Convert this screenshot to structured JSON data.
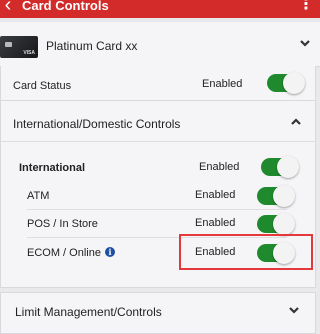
{
  "appbar": {
    "title": "Card Controls",
    "back_icon": "chevron-left-icon",
    "more_icon": "more-vertical-icon",
    "background": "#d32a2a"
  },
  "card": {
    "name": "Platinum Card xx",
    "brand_mark": "VISA"
  },
  "card_status": {
    "label": "Card Status",
    "value": "Enabled",
    "enabled": true
  },
  "intl_section": {
    "title": "International/Domestic Controls",
    "rows": [
      {
        "label": "International",
        "value": "Enabled",
        "enabled": true
      },
      {
        "label": "ATM",
        "value": "Enabled",
        "enabled": true
      },
      {
        "label": "POS / In Store",
        "value": "Enabled",
        "enabled": true
      },
      {
        "label": "ECOM / Online",
        "value": "Enabled",
        "enabled": true
      }
    ],
    "info_glyph": "i"
  },
  "limit_section": {
    "title": "Limit Management/Controls"
  },
  "colors": {
    "toggle_on": "#1f8a2d",
    "highlight": "#e23a3a"
  }
}
